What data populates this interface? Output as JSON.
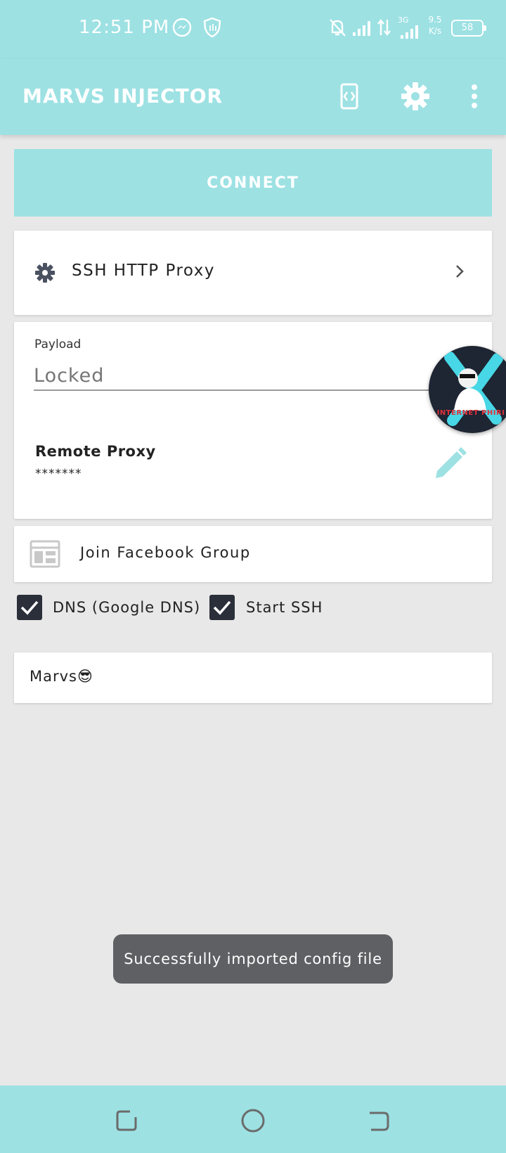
{
  "status_bar": {
    "time": "12:51 PM",
    "network_type": "3G",
    "speed_value": "9.5",
    "speed_unit": "K/s",
    "battery": "58",
    "icons": [
      "messenger-icon",
      "shield-icon",
      "bell-off-icon",
      "signal-icon",
      "data-arrows-icon",
      "signal-3g-icon",
      "battery-icon"
    ]
  },
  "app_bar": {
    "title": "MARVS INJECTOR",
    "icons": [
      "screen-rotate-icon",
      "settings-icon",
      "more-vert-icon"
    ]
  },
  "connect_label": "CONNECT",
  "tunnel": {
    "mode_label": "SSH HTTP Proxy"
  },
  "form": {
    "payload_label": "Payload",
    "payload_placeholder": "Locked",
    "remote_title": "Remote Proxy",
    "remote_value": "*******"
  },
  "facebook_label": "Join Facebook Group",
  "checkboxes": [
    {
      "label": "DNS (Google DNS)",
      "checked": true
    },
    {
      "label": "Start SSH",
      "checked": true
    }
  ],
  "note": "Marvs😎",
  "fab_badge_text": "INTERNET PHIRI",
  "toast": "Successfully imported config file",
  "colors": {
    "accent": "#9de1e3",
    "background": "#e8e8e8",
    "checkbox": "#2b2f3a",
    "toast": "#5f6064"
  }
}
